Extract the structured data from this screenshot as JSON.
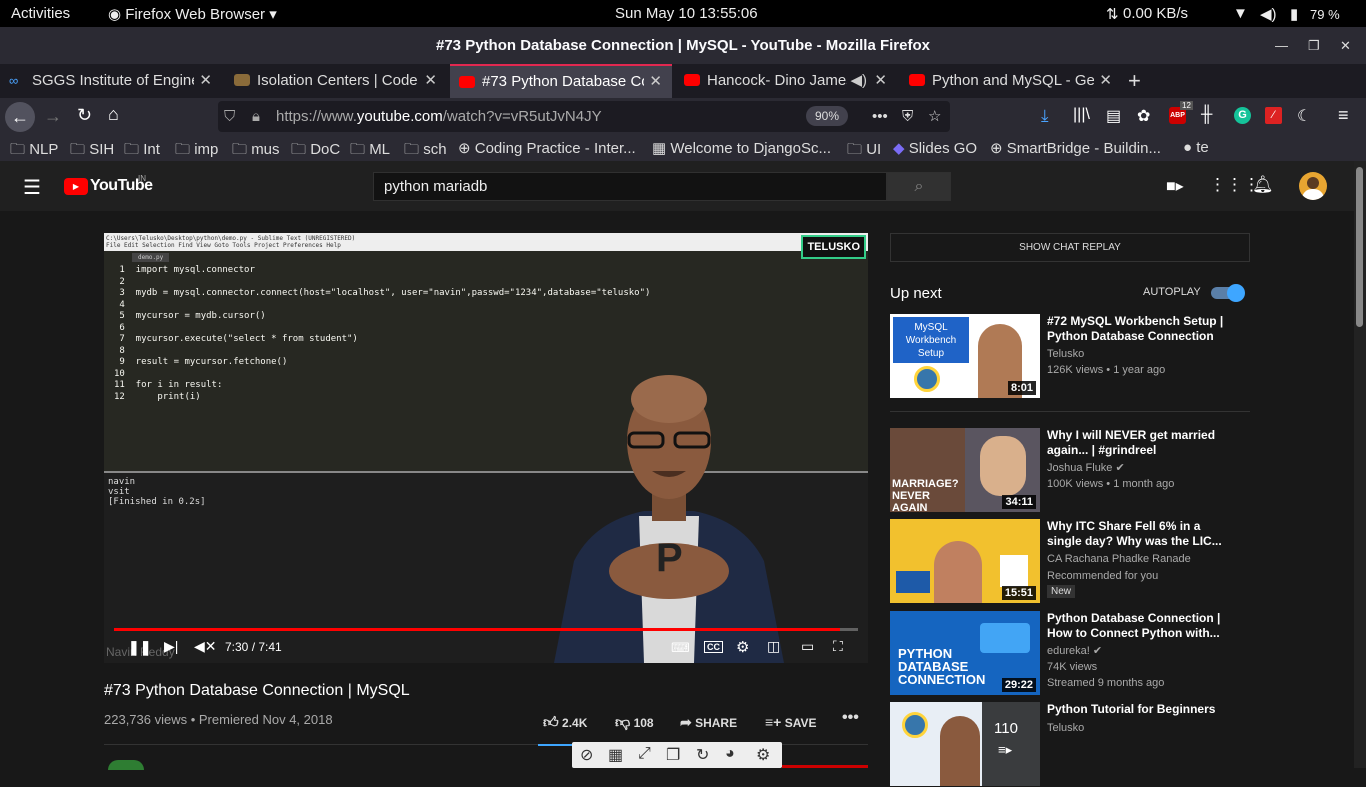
{
  "system": {
    "activities": "Activities",
    "app": "Firefox Web Browser",
    "clock": "Sun May 10  13:55:06",
    "net": "0.00 KB/s",
    "battery": "79 %"
  },
  "window": {
    "title": "#73 Python Database Connection | MySQL - YouTube - Mozilla Firefox"
  },
  "tabs": [
    {
      "label": "SGGS Institute of Engine"
    },
    {
      "label": "Isolation Centers | Code"
    },
    {
      "label": "#73 Python Database Co"
    },
    {
      "label": "Hancock- Dino James"
    },
    {
      "label": "Python and MySQL - Get"
    }
  ],
  "url": {
    "prefix": "https://www.",
    "domain": "youtube.com",
    "path": "/watch?v=vR5utJvN4JY",
    "zoom": "90%",
    "abp_count": "12"
  },
  "bookmarks": [
    "NLP",
    "SIH",
    "Int",
    "imp",
    "mus",
    "DoC",
    "ML",
    "sch",
    "Coding Practice - Inter...",
    "Welcome to DjangoSc...",
    "UI",
    "Slides GO",
    "SmartBridge - Buildin...",
    "te"
  ],
  "yt": {
    "logo": "YouTube",
    "region": "IN",
    "search_value": "python mariadb"
  },
  "video": {
    "time": "7:30 / 7:41",
    "progress": 0.976,
    "editor_title": "C:\\Users\\Telusko\\Desktop\\python\\demo.py - Sublime Text (UNREGISTERED)",
    "menu": "File  Edit  Selection  Find  View  Goto  Tools  Project  Preferences  Help",
    "code": " 1  import mysql.connector\n 2\n 3  mydb = mysql.connector.connect(host=\"localhost\", user=\"navin\",passwd=\"1234\",database=\"telusko\")\n 4\n 5  mycursor = mydb.cursor()\n 6\n 7  mycursor.execute(\"select * from student\")\n 8\n 9  result = mycursor.fetchone()\n10\n11  for i in result:\n12      print(i)",
    "output": "navin\nvsit\n[Finished in 0.2s]",
    "watermark": "TELUSKO",
    "presenter": "Navin Reddy"
  },
  "info": {
    "title": "#73 Python Database Connection | MySQL",
    "meta": "223,736 views • Premiered Nov 4, 2018",
    "likes": "2.4K",
    "dislikes": "108",
    "share": "SHARE",
    "save": "SAVE"
  },
  "sidebar": {
    "chat_replay": "SHOW CHAT REPLAY",
    "up_next": "Up next",
    "autoplay": "AUTOPLAY",
    "cards": [
      {
        "title": "#72 MySQL Workbench Setup | Python Database Connection",
        "channel": "Telusko",
        "meta": "126K views • 1 year ago",
        "duration": "8:01",
        "thumb_text": "MySQL Workbench Setup"
      },
      {
        "title": "Why I will NEVER get married again... | #grindreel",
        "channel": "Joshua Fluke",
        "meta": "100K views • 1 month ago",
        "duration": "34:11",
        "thumb_text": "MARRIAGE? NEVER AGAIN"
      },
      {
        "title": "Why ITC Share Fell 6% in a single day? Why was the LIC...",
        "channel": "CA Rachana Phadke Ranade",
        "meta": "Recommended for you",
        "duration": "15:51",
        "badge": "New"
      },
      {
        "title": "Python Database Connection | How to Connect Python with...",
        "channel": "edureka!",
        "meta": "74K views",
        "meta2": "Streamed 9 months ago",
        "duration": "29:22",
        "thumb_text": "PYTHON DATABASE CONNECTION"
      },
      {
        "title": "Python Tutorial for Beginners",
        "channel": "Telusko",
        "duration": "110"
      }
    ]
  }
}
